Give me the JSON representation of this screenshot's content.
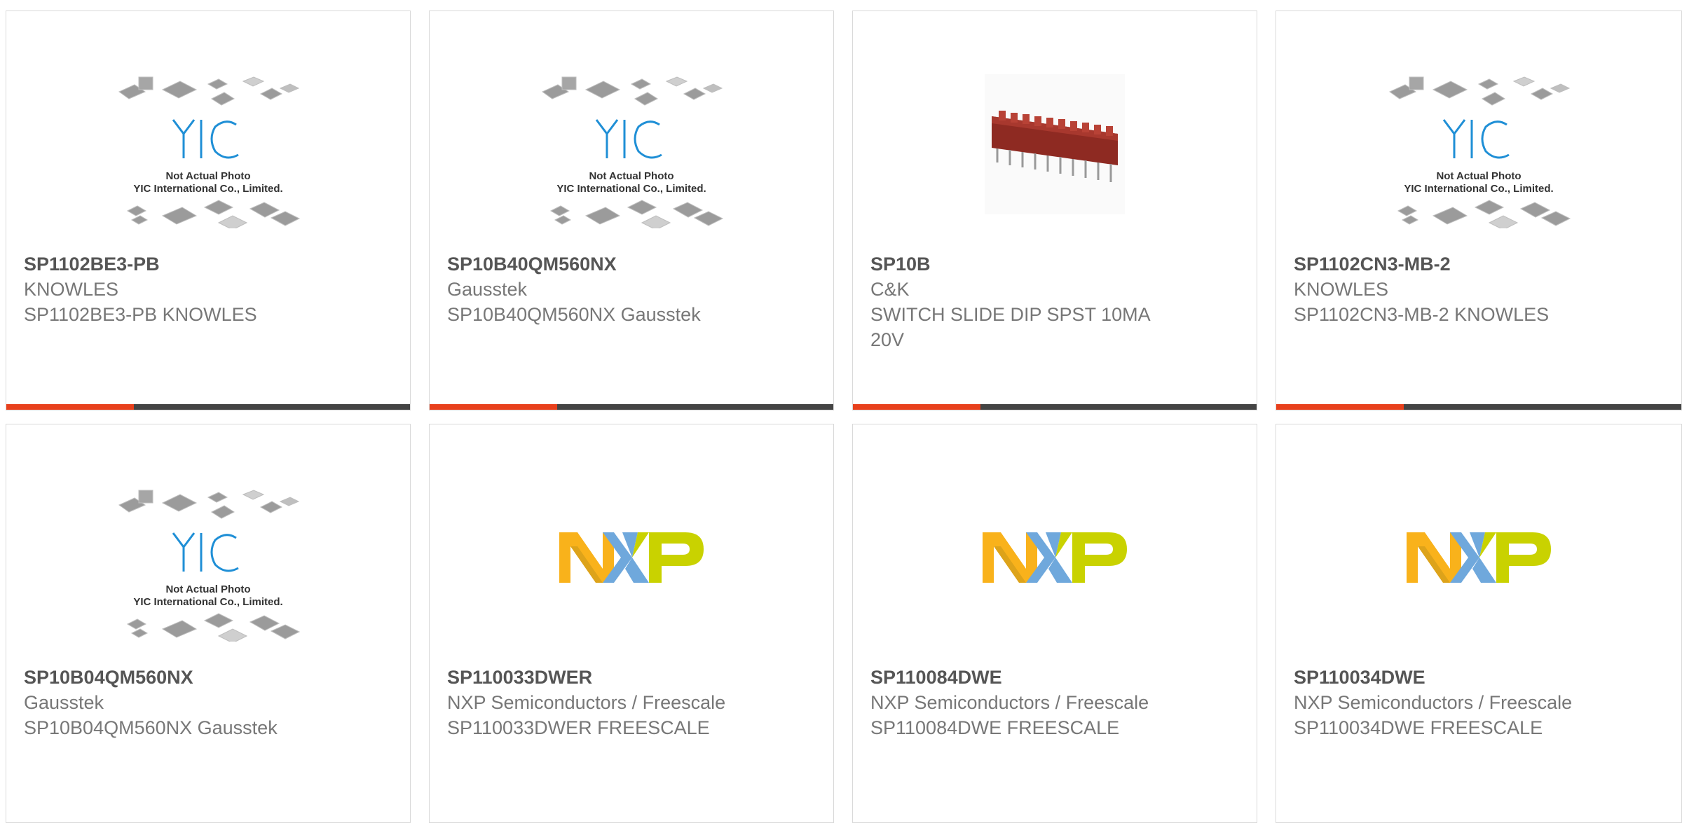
{
  "colors": {
    "accent": "#e8401c",
    "bar": "#444444",
    "yic_blue": "#1f8fd6"
  },
  "products": [
    {
      "part_number": "SP1102BE3-PB",
      "manufacturer": "KNOWLES",
      "description": "SP1102BE3-PB KNOWLES",
      "image": "yic-placeholder",
      "image_caption_1": "Not Actual Photo",
      "image_caption_2": "YIC International Co., Limited."
    },
    {
      "part_number": "SP10B40QM560NX",
      "manufacturer": "Gausstek",
      "description": "SP10B40QM560NX Gausstek",
      "image": "yic-placeholder",
      "image_caption_1": "Not Actual Photo",
      "image_caption_2": "YIC International Co., Limited."
    },
    {
      "part_number": "SP10B",
      "manufacturer": "C&K",
      "description": "SWITCH SLIDE DIP SPST 10MA 20V",
      "image": "dip-switch-photo"
    },
    {
      "part_number": "SP1102CN3-MB-2",
      "manufacturer": "KNOWLES",
      "description": "SP1102CN3-MB-2 KNOWLES",
      "image": "yic-placeholder",
      "image_caption_1": "Not Actual Photo",
      "image_caption_2": "YIC International Co., Limited."
    },
    {
      "part_number": "SP10B04QM560NX",
      "manufacturer": "Gausstek",
      "description": "SP10B04QM560NX Gausstek",
      "image": "yic-placeholder",
      "image_caption_1": "Not Actual Photo",
      "image_caption_2": "YIC International Co., Limited."
    },
    {
      "part_number": "SP110033DWER",
      "manufacturer": "NXP Semiconductors / Freescale",
      "description": "SP110033DWER FREESCALE",
      "image": "nxp-logo"
    },
    {
      "part_number": "SP110084DWE",
      "manufacturer": "NXP Semiconductors / Freescale",
      "description": "SP110084DWE FREESCALE",
      "image": "nxp-logo"
    },
    {
      "part_number": "SP110034DWE",
      "manufacturer": "NXP Semiconductors / Freescale",
      "description": "SP110034DWE FREESCALE",
      "image": "nxp-logo"
    }
  ]
}
